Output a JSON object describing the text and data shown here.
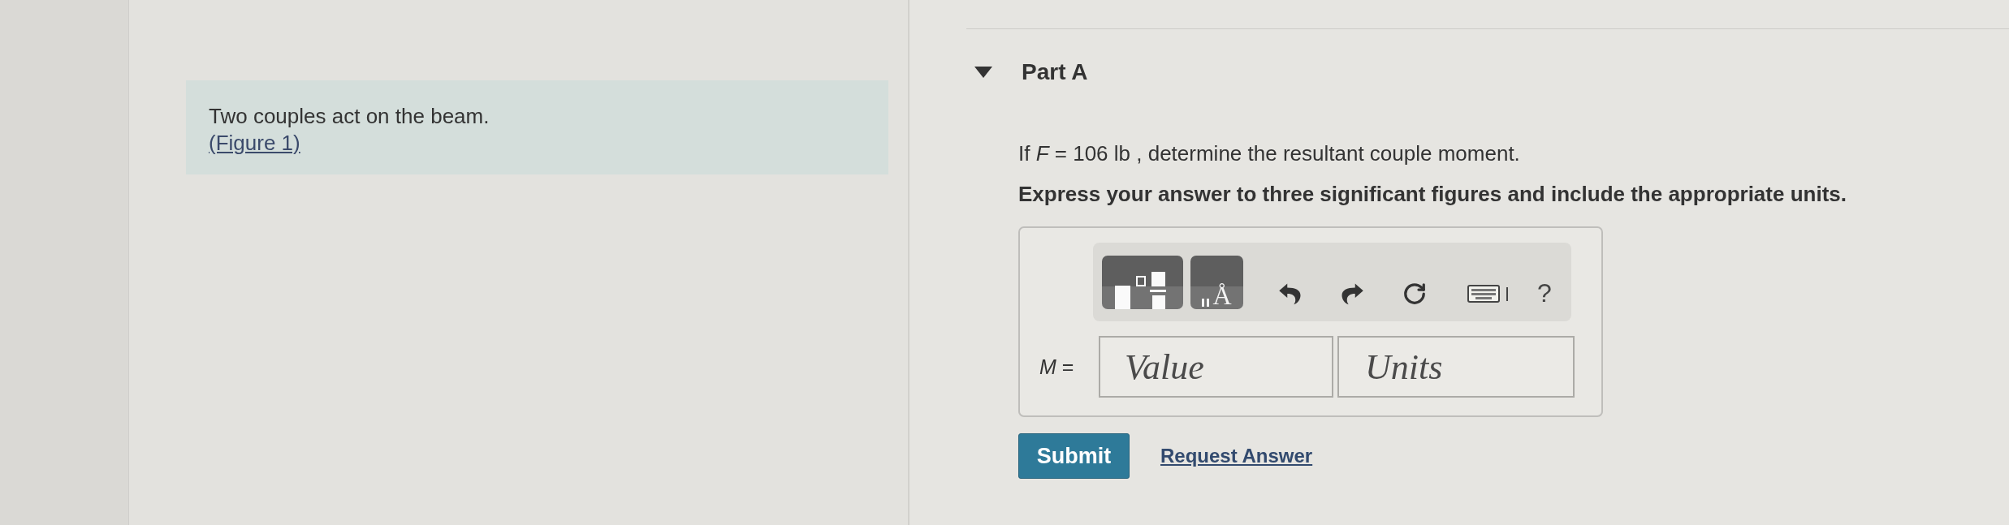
{
  "problem_intro": {
    "text": "Two couples act on the beam.",
    "figure_link": "(Figure 1)"
  },
  "part": {
    "title": "Part A",
    "expanded": true,
    "question": "If *F* = 106 lb , determine the resultant couple moment.",
    "instruction": "Express your answer to three significant figures and include the appropriate units.",
    "answer": {
      "toolbar": {
        "units_symbol": "Å",
        "help": "?"
      },
      "label": "*M* =",
      "value_field": {
        "placeholder": "Value"
      },
      "units_field": {
        "placeholder": "Units"
      }
    },
    "submit": "Submit",
    "request_answer": "Request Answer"
  }
}
